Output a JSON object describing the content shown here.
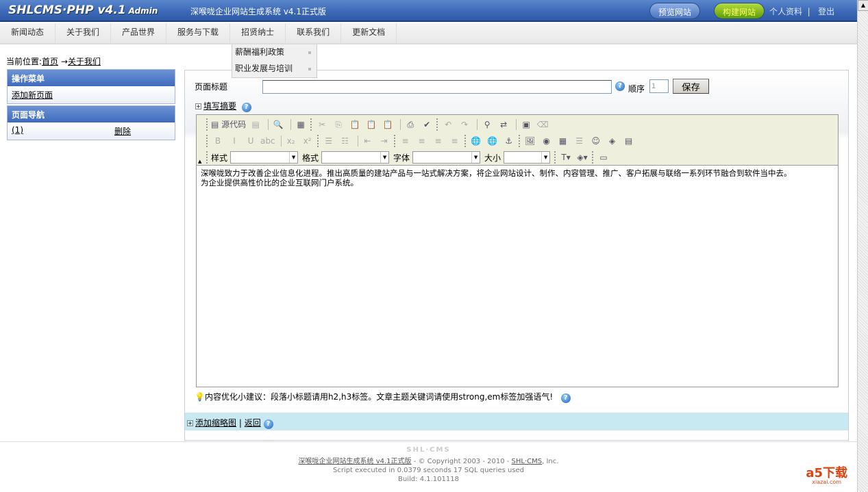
{
  "header": {
    "logo": "SHLCMS·PHP v4.1",
    "logo_suffix": "Admin",
    "system_name": "深喉咙企业网站生成系统  v4.1正式版",
    "preview_button": "预览网站",
    "build_button": "构建网站",
    "profile_link": "个人资料",
    "separator": "|",
    "logout_link": "登出"
  },
  "nav": {
    "items": [
      "新闻动态",
      "关于我们",
      "产品世界",
      "服务与下载",
      "招贤纳士",
      "联系我们",
      "更新文档"
    ],
    "dropdown": [
      "薪酬福利政策",
      "职业发展与培训"
    ]
  },
  "breadcrumb": {
    "label": "当前位置:",
    "home": "首页",
    "arrow": "→",
    "current": "关于我们"
  },
  "sidebar": {
    "menu_title": "操作菜单",
    "add_page": "添加新页面",
    "nav_title": "页面导航",
    "page_item": "(1)",
    "delete": "删除"
  },
  "form": {
    "title_label": "页面标题",
    "title_value": "",
    "order_label": "顺序",
    "order_value": "1",
    "save_button": "保存",
    "summary_link": "填写摘要",
    "help": "?"
  },
  "editor": {
    "source_label": "源代码",
    "toolbar": [
      [
        "grip",
        "source",
        "dim:paste-template-icon|▤",
        "sep",
        "preview-icon|🔍",
        "sep",
        "document-icon|▦",
        "grip",
        "dim:cut-icon|✂",
        "dim:copy-icon|⎘",
        "dim:paste-icon|📋",
        "dim:paste-text-icon|📋",
        "dim:paste-word-icon|📋",
        "sep",
        "print-icon|⎙",
        "spellcheck-icon|✔",
        "grip",
        "dim:undo-icon|↶",
        "dim:redo-icon|↷",
        "sep",
        "find-icon|⚲",
        "replace-icon|⇄",
        "sep",
        "select-all-icon|▣",
        "dim:remove-format-icon|⌫"
      ],
      [
        "grip",
        "dim:bold-icon|B",
        "dim:italic-icon|I",
        "dim:underline-icon|U",
        "dim:strikethrough-icon|abc",
        "sep",
        "dim:subscript-icon|x₂",
        "dim:superscript-icon|x²",
        "grip",
        "dim:ordered-list-icon|☰",
        "dim:unordered-list-icon|☷",
        "sep",
        "dim:outdent-icon|⇤",
        "dim:indent-icon|⇥",
        "grip",
        "dim:align-left-icon|≡",
        "dim:align-center-icon|≡",
        "dim:align-right-icon|≡",
        "dim:justify-icon|≡",
        "grip",
        "link-icon|🌐",
        "dim:unlink-icon|🌐",
        "anchor-icon|⚓",
        "grip",
        "image-icon|🖼",
        "flash-icon|◉",
        "table-icon|▦",
        "dim:horizontal-rule-icon|☰",
        "smiley-icon|☺",
        "special-char-icon|◈",
        "page-break-icon|▤"
      ]
    ],
    "combos": {
      "style": "样式",
      "format": "格式",
      "font": "字体",
      "size": "大小"
    },
    "content_lines": [
      "深喉咙致力于改善企业信息化进程。推出高质量的建站产品与一站式解决方案，将企业网站设计、制作、内容管理、推广、客户拓展与联络一系列环节融合到软件当中去。",
      "为企业提供高性价比的企业互联网门户系统。"
    ]
  },
  "tip": "内容优化小建议：段落小标题请用h2,h3标签。文章主题关键词请使用strong,em标签加强语气!",
  "thumb": {
    "add_link": "添加缩略图",
    "separator": "|",
    "back_link": "返回"
  },
  "footer": {
    "brand": "SHL·CMS",
    "product_link": "深喉咙企业网站生成系统 v4.1正式版",
    "copyright": " - © Copyright 2003 - 2010 - ",
    "company_link": "SHL·CMS",
    "suffix": ", Inc.",
    "stats": "Script executed in 0.0379 seconds 17 SQL queries used",
    "build": "Build: 4.1.101118"
  },
  "watermark": {
    "text": "a5下载",
    "url_text": "xiazai.com"
  }
}
